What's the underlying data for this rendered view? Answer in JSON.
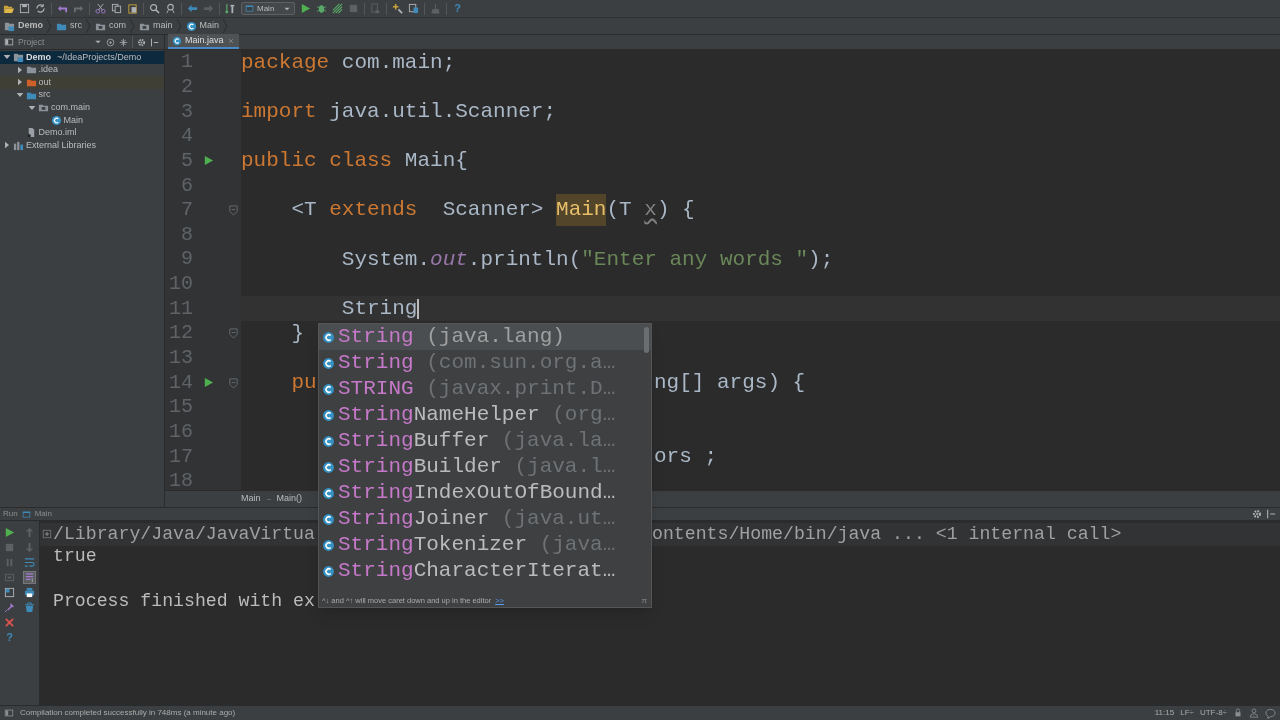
{
  "toolbar": {
    "run_config": "Main",
    "help": "?"
  },
  "nav_bar": [
    {
      "label": "Demo",
      "kind": "project"
    },
    {
      "label": "src",
      "kind": "source"
    },
    {
      "label": "com",
      "kind": "package"
    },
    {
      "label": "main",
      "kind": "package"
    },
    {
      "label": "Main",
      "kind": "class"
    }
  ],
  "project_panel": {
    "title": "Project",
    "tree": [
      {
        "label": "Demo",
        "detail": "~/IdeaProjects/Demo",
        "kind": "project",
        "expanded": true,
        "selected": true,
        "children": [
          {
            "label": ".idea",
            "kind": "folder",
            "expanded": false,
            "selected": false
          },
          {
            "label": "out",
            "kind": "excluded",
            "expanded": false,
            "selected": false
          },
          {
            "label": "src",
            "kind": "source",
            "expanded": true,
            "selected": false,
            "children": [
              {
                "label": "com.main",
                "kind": "package",
                "expanded": true,
                "selected": false,
                "children": [
                  {
                    "label": "Main",
                    "kind": "class",
                    "selected": false
                  }
                ]
              }
            ]
          },
          {
            "label": "Demo.iml",
            "kind": "file",
            "selected": false
          }
        ]
      },
      {
        "label": "External Libraries",
        "kind": "library",
        "expanded": false,
        "selected": false
      }
    ]
  },
  "editor": {
    "tabs": [
      {
        "label": "Main.java",
        "selected": true
      }
    ],
    "lines": [
      {
        "number": "1",
        "current": false,
        "segments": [
          {
            "text": "package",
            "kind": "keyword"
          },
          {
            "text": " com.main;",
            "kind": "plain"
          }
        ]
      },
      {
        "number": "2",
        "current": false
      },
      {
        "number": "3",
        "current": false,
        "segments": [
          {
            "text": "import",
            "kind": "keyword"
          },
          {
            "text": " java.util.Scanner;",
            "kind": "plain"
          }
        ]
      },
      {
        "number": "4",
        "current": false
      },
      {
        "number": "5",
        "current": false,
        "run_gutter": true,
        "segments": [
          {
            "text": "public class",
            "kind": "keyword"
          },
          {
            "text": " Main{",
            "kind": "plain"
          }
        ]
      },
      {
        "number": "6",
        "current": false
      },
      {
        "number": "7",
        "current": false,
        "fold_gutter": true,
        "segments": [
          {
            "text": "    <T ",
            "kind": "plain"
          },
          {
            "text": "extends",
            "kind": "keyword"
          },
          {
            "text": "  Scanner> ",
            "kind": "plain"
          },
          {
            "text": "Main",
            "kind": "highlight"
          },
          {
            "text": "(T ",
            "kind": "plain"
          },
          {
            "text": "x",
            "kind": "unused"
          },
          {
            "text": ") {",
            "kind": "plain"
          }
        ]
      },
      {
        "number": "8",
        "current": false
      },
      {
        "number": "9",
        "current": false,
        "segments": [
          {
            "text": "        System.",
            "kind": "plain"
          },
          {
            "text": "out",
            "kind": "field"
          },
          {
            "text": ".println(",
            "kind": "plain"
          },
          {
            "text": "\"Enter any words \"",
            "kind": "string"
          },
          {
            "text": ");",
            "kind": "plain"
          }
        ]
      },
      {
        "number": "10",
        "current": false
      },
      {
        "number": "11",
        "current": true,
        "segments": [
          {
            "text": "        String",
            "kind": "plain"
          }
        ]
      },
      {
        "number": "12",
        "current": false,
        "fold_gutter": true,
        "segments": [
          {
            "text": "    }",
            "kind": "plain"
          }
        ]
      },
      {
        "number": "13",
        "current": false
      },
      {
        "number": "14",
        "current": false,
        "run_gutter": true,
        "fold_gutter": true,
        "segments": [
          {
            "text": "    pu",
            "kind": "keyword"
          }
        ],
        "after_popup": [
          {
            "text": "ng[] args) {",
            "kind": "plain"
          }
        ]
      },
      {
        "number": "15",
        "current": false
      },
      {
        "number": "16",
        "current": false
      },
      {
        "number": "17",
        "current": false,
        "after_popup": [
          {
            "text": "ors ;",
            "kind": "plain"
          }
        ]
      },
      {
        "number": "18",
        "current": false
      }
    ],
    "breadcrumbs": [
      "Main",
      "Main()"
    ]
  },
  "completion": {
    "items": [
      {
        "match": "String",
        "package": "(java.lang)",
        "selected": true
      },
      {
        "match": "String",
        "package": "(com.sun.org.a…",
        "selected": false
      },
      {
        "match": "STRING",
        "package": "(javax.print.D…",
        "selected": false
      },
      {
        "match": "String",
        "rest": "NameHelper",
        "package": "(org…",
        "selected": false
      },
      {
        "match": "String",
        "rest": "Buffer",
        "package": "(java.la…",
        "selected": false
      },
      {
        "match": "String",
        "rest": "Builder",
        "package": "(java.l…",
        "selected": false
      },
      {
        "match": "String",
        "rest": "IndexOutOfBound…",
        "selected": false
      },
      {
        "match": "String",
        "rest": "Joiner",
        "package": "(java.ut…",
        "selected": false
      },
      {
        "match": "String",
        "rest": "Tokenizer",
        "package": "(java…",
        "selected": false
      },
      {
        "match": "String",
        "rest": "CharacterIterat…",
        "selected": false
      }
    ],
    "hint": "^↓ and ^↑ will move caret down and up in the editor",
    "hint_link": ">>",
    "hint_mark": "π"
  },
  "run_panel": {
    "title": "Run",
    "config": "Main",
    "help": "?",
    "console": [
      {
        "kind": "command",
        "text": "/Library/Java/JavaVirtua",
        "after_popup": "ontents/Home/bin/java ... <1 internal call>"
      },
      {
        "kind": "output",
        "text": "true"
      },
      {
        "kind": "blank"
      },
      {
        "kind": "output",
        "text": "Process finished with ex"
      }
    ]
  },
  "status_bar": {
    "message": "Compilation completed successfully in 748ms (a minute ago)",
    "position": "11:15",
    "line_separator": "LF÷",
    "encoding": "UTF-8÷"
  }
}
